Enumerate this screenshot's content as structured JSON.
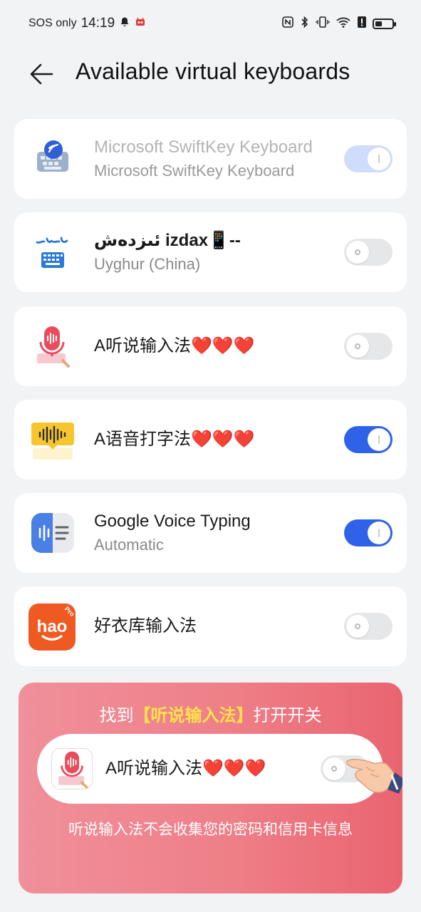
{
  "status_bar": {
    "carrier": "SOS only",
    "time": "14:19",
    "icons": [
      "bell-icon",
      "app-notification-icon",
      "nfc-icon",
      "bluetooth-icon",
      "vibrate-icon",
      "wifi-icon",
      "alert-icon",
      "battery-icon"
    ]
  },
  "header": {
    "back_icon": "arrow-left-icon",
    "title": "Available virtual keyboards"
  },
  "keyboards": [
    {
      "title": "Microsoft SwiftKey Keyboard",
      "subtitle": "Microsoft SwiftKey Keyboard",
      "enabled": true,
      "locked": true,
      "icon": "swiftkey-icon"
    },
    {
      "title": "ئىزدەش izdax📱--",
      "subtitle": "Uyghur (China)",
      "enabled": false,
      "locked": false,
      "icon": "izdax-icon"
    },
    {
      "title": "A听说输入法❤️❤️❤️",
      "subtitle": "",
      "enabled": false,
      "locked": false,
      "icon": "microphone-keyboard-icon"
    },
    {
      "title": "A语音打字法❤️❤️❤️",
      "subtitle": "",
      "enabled": true,
      "locked": false,
      "icon": "voice-bubble-icon"
    },
    {
      "title": "Google Voice Typing",
      "subtitle": "Automatic",
      "enabled": true,
      "locked": false,
      "icon": "google-voice-typing-icon"
    },
    {
      "title": "好衣库输入法",
      "subtitle": "",
      "enabled": false,
      "locked": false,
      "icon": "hao-pro-icon"
    }
  ],
  "promo": {
    "headline_prefix": "找到",
    "headline_highlight": "【听说输入法】",
    "headline_suffix": "打开开关",
    "pill_label": "A听说输入法❤️❤️❤️",
    "pill_toggle_enabled": false,
    "footer": "听说输入法不会收集您的密码和信用卡信息",
    "colors": {
      "gradient_start": "#f0909a",
      "gradient_end": "#ea6470",
      "highlight": "#ffe24a"
    }
  },
  "colors": {
    "accent": "#2f62e8",
    "background": "#f1f3f5",
    "card": "#ffffff"
  }
}
